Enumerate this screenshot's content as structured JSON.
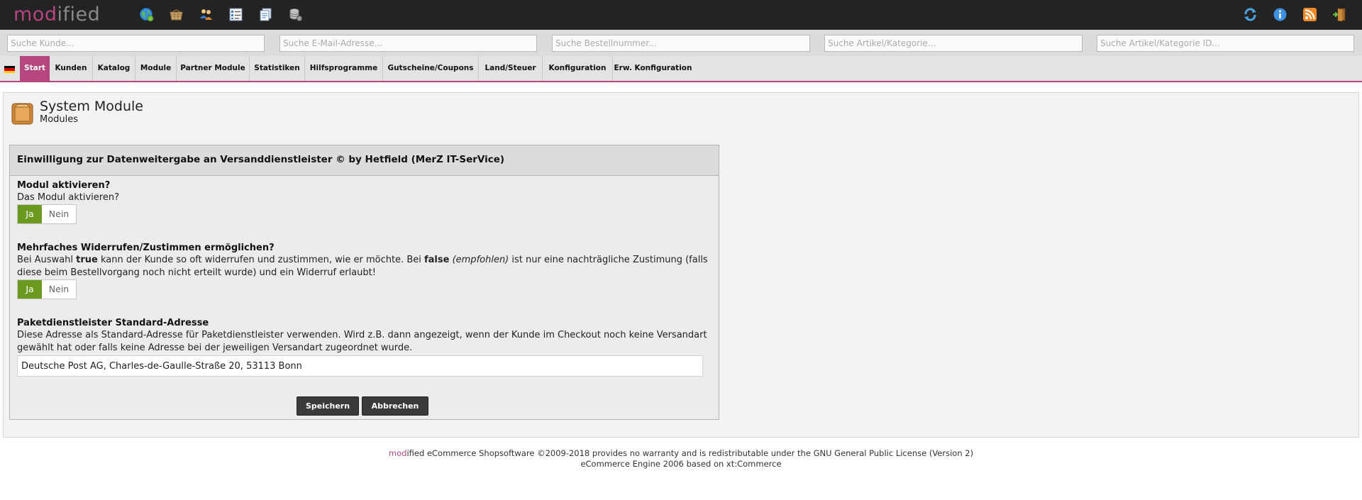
{
  "brand": {
    "logo_part1": "mod",
    "logo_part2": "ified",
    "accent_color": "#b5467f",
    "topbar_color": "#232323"
  },
  "topbar_icons": [
    "globe-icon",
    "shop-basket-icon",
    "users-icon",
    "checklist-icon",
    "documents-icon",
    "database-icon",
    "refresh-icon",
    "info-icon",
    "rss-icon",
    "logout-icon"
  ],
  "search": {
    "customer_placeholder": "Suche Kunde...",
    "email_placeholder": "Suche E-Mail-Adresse...",
    "order_placeholder": "Suche Bestellnummer...",
    "article_placeholder": "Suche Artikel/Kategorie...",
    "article_id_placeholder": "Suche Artikel/Kategorie ID..."
  },
  "nav": {
    "flag": "german-flag-icon",
    "items": [
      {
        "label": "Start"
      },
      {
        "label": "Kunden"
      },
      {
        "label": "Katalog"
      },
      {
        "label": "Module"
      },
      {
        "label": "Partner Module"
      },
      {
        "label": "Statistiken"
      },
      {
        "label": "Hilfsprogramme"
      },
      {
        "label": "Gutscheine/Coupons"
      },
      {
        "label": "Land/Steuer"
      },
      {
        "label": "Konfiguration"
      },
      {
        "label": "Erw. Konfiguration"
      }
    ],
    "active": "Start"
  },
  "page": {
    "title": "System Module",
    "subtitle": "Modules",
    "icon": "module-box-icon"
  },
  "module": {
    "heading": "Einwilligung zur Datenweitergabe an Versanddienstleister © by Hetfield (MerZ IT-SerVice)",
    "fields": [
      {
        "title": "Modul aktivieren?",
        "description": "Das Modul aktivieren?",
        "yes_label": "Ja",
        "no_label": "Nein",
        "selected": "Ja"
      },
      {
        "title": "Mehrfaches Widerrufen/Zustimmen ermöglichen?",
        "desc_part1": "Bei Auswahl ",
        "desc_true": "true",
        "desc_part2": " kann der Kunde so oft widerrufen und zustimmen, wie er möchte. Bei ",
        "desc_false": "false",
        "desc_space": " ",
        "desc_recommended": "(empfohlen)",
        "desc_part3": " ist nur eine nachträgliche Zustimung (falls diese beim Bestellvorgang noch nicht erteilt wurde) und ein Widerruf erlaubt!",
        "yes_label": "Ja",
        "no_label": "Nein",
        "selected": "Ja"
      },
      {
        "title": "Paketdienstleister Standard-Adresse",
        "description": "Diese Adresse als Standard-Adresse für Paketdienstleister verwenden. Wird z.B. dann angezeigt, wenn der Kunde im Checkout noch keine Versandart gewählt hat oder falls keine Adresse bei der jeweiligen Versandart zugeordnet wurde.",
        "value": "Deutsche Post AG, Charles-de-Gaulle-Straße 20, 53113 Bonn"
      }
    ],
    "save_label": "Speichern",
    "cancel_label": "Abbrechen"
  },
  "footer": {
    "brand_part1": "mod",
    "brand_part2": "ified",
    "line1_rest": " eCommerce Shopsoftware ©2009-2018 provides no warranty and is redistributable under the GNU General Public License (Version 2)",
    "line2": "eCommerce Engine 2006 based on xt:Commerce"
  }
}
